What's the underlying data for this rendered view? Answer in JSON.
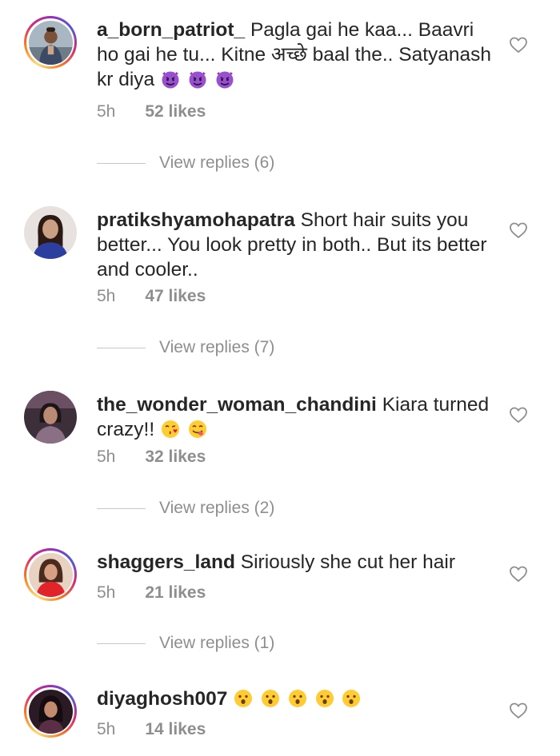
{
  "comments": [
    {
      "username": "a_born_patriot_",
      "text": "Pagla gai he kaa... Baavri ho gai he tu... Kitne अच्छे baal the.. Satyanash kr diya",
      "emojis": [
        "smiling-imp",
        "smiling-imp",
        "smiling-imp"
      ],
      "time": "5h",
      "likes": "52 likes",
      "replies": "View replies (6)",
      "has_story": true
    },
    {
      "username": "pratikshyamohapatra",
      "text": "Short hair suits you better... You look pretty in both.. But its better and cooler..",
      "emojis": [],
      "time": "5h",
      "likes": "47 likes",
      "replies": "View replies (7)",
      "has_story": false
    },
    {
      "username": "the_wonder_woman_chandini",
      "text": "Kiara turned crazy!!",
      "emojis": [
        "kissing-heart",
        "yum"
      ],
      "time": "5h",
      "likes": "32 likes",
      "replies": "View replies (2)",
      "has_story": false
    },
    {
      "username": "shaggers_land",
      "text": "Siriously she cut her hair",
      "emojis": [],
      "time": "5h",
      "likes": "21 likes",
      "replies": "View replies (1)",
      "has_story": true
    },
    {
      "username": "diyaghosh007",
      "text": "",
      "emojis": [
        "open-mouth",
        "open-mouth",
        "open-mouth",
        "open-mouth",
        "open-mouth"
      ],
      "time": "5h",
      "likes": "14 likes",
      "replies": "",
      "has_story": true
    }
  ],
  "icons": {
    "like": "heart-outline-icon"
  },
  "colors": {
    "text": "#262626",
    "secondary": "#8e8e8e",
    "divider": "#c7c7c7"
  }
}
